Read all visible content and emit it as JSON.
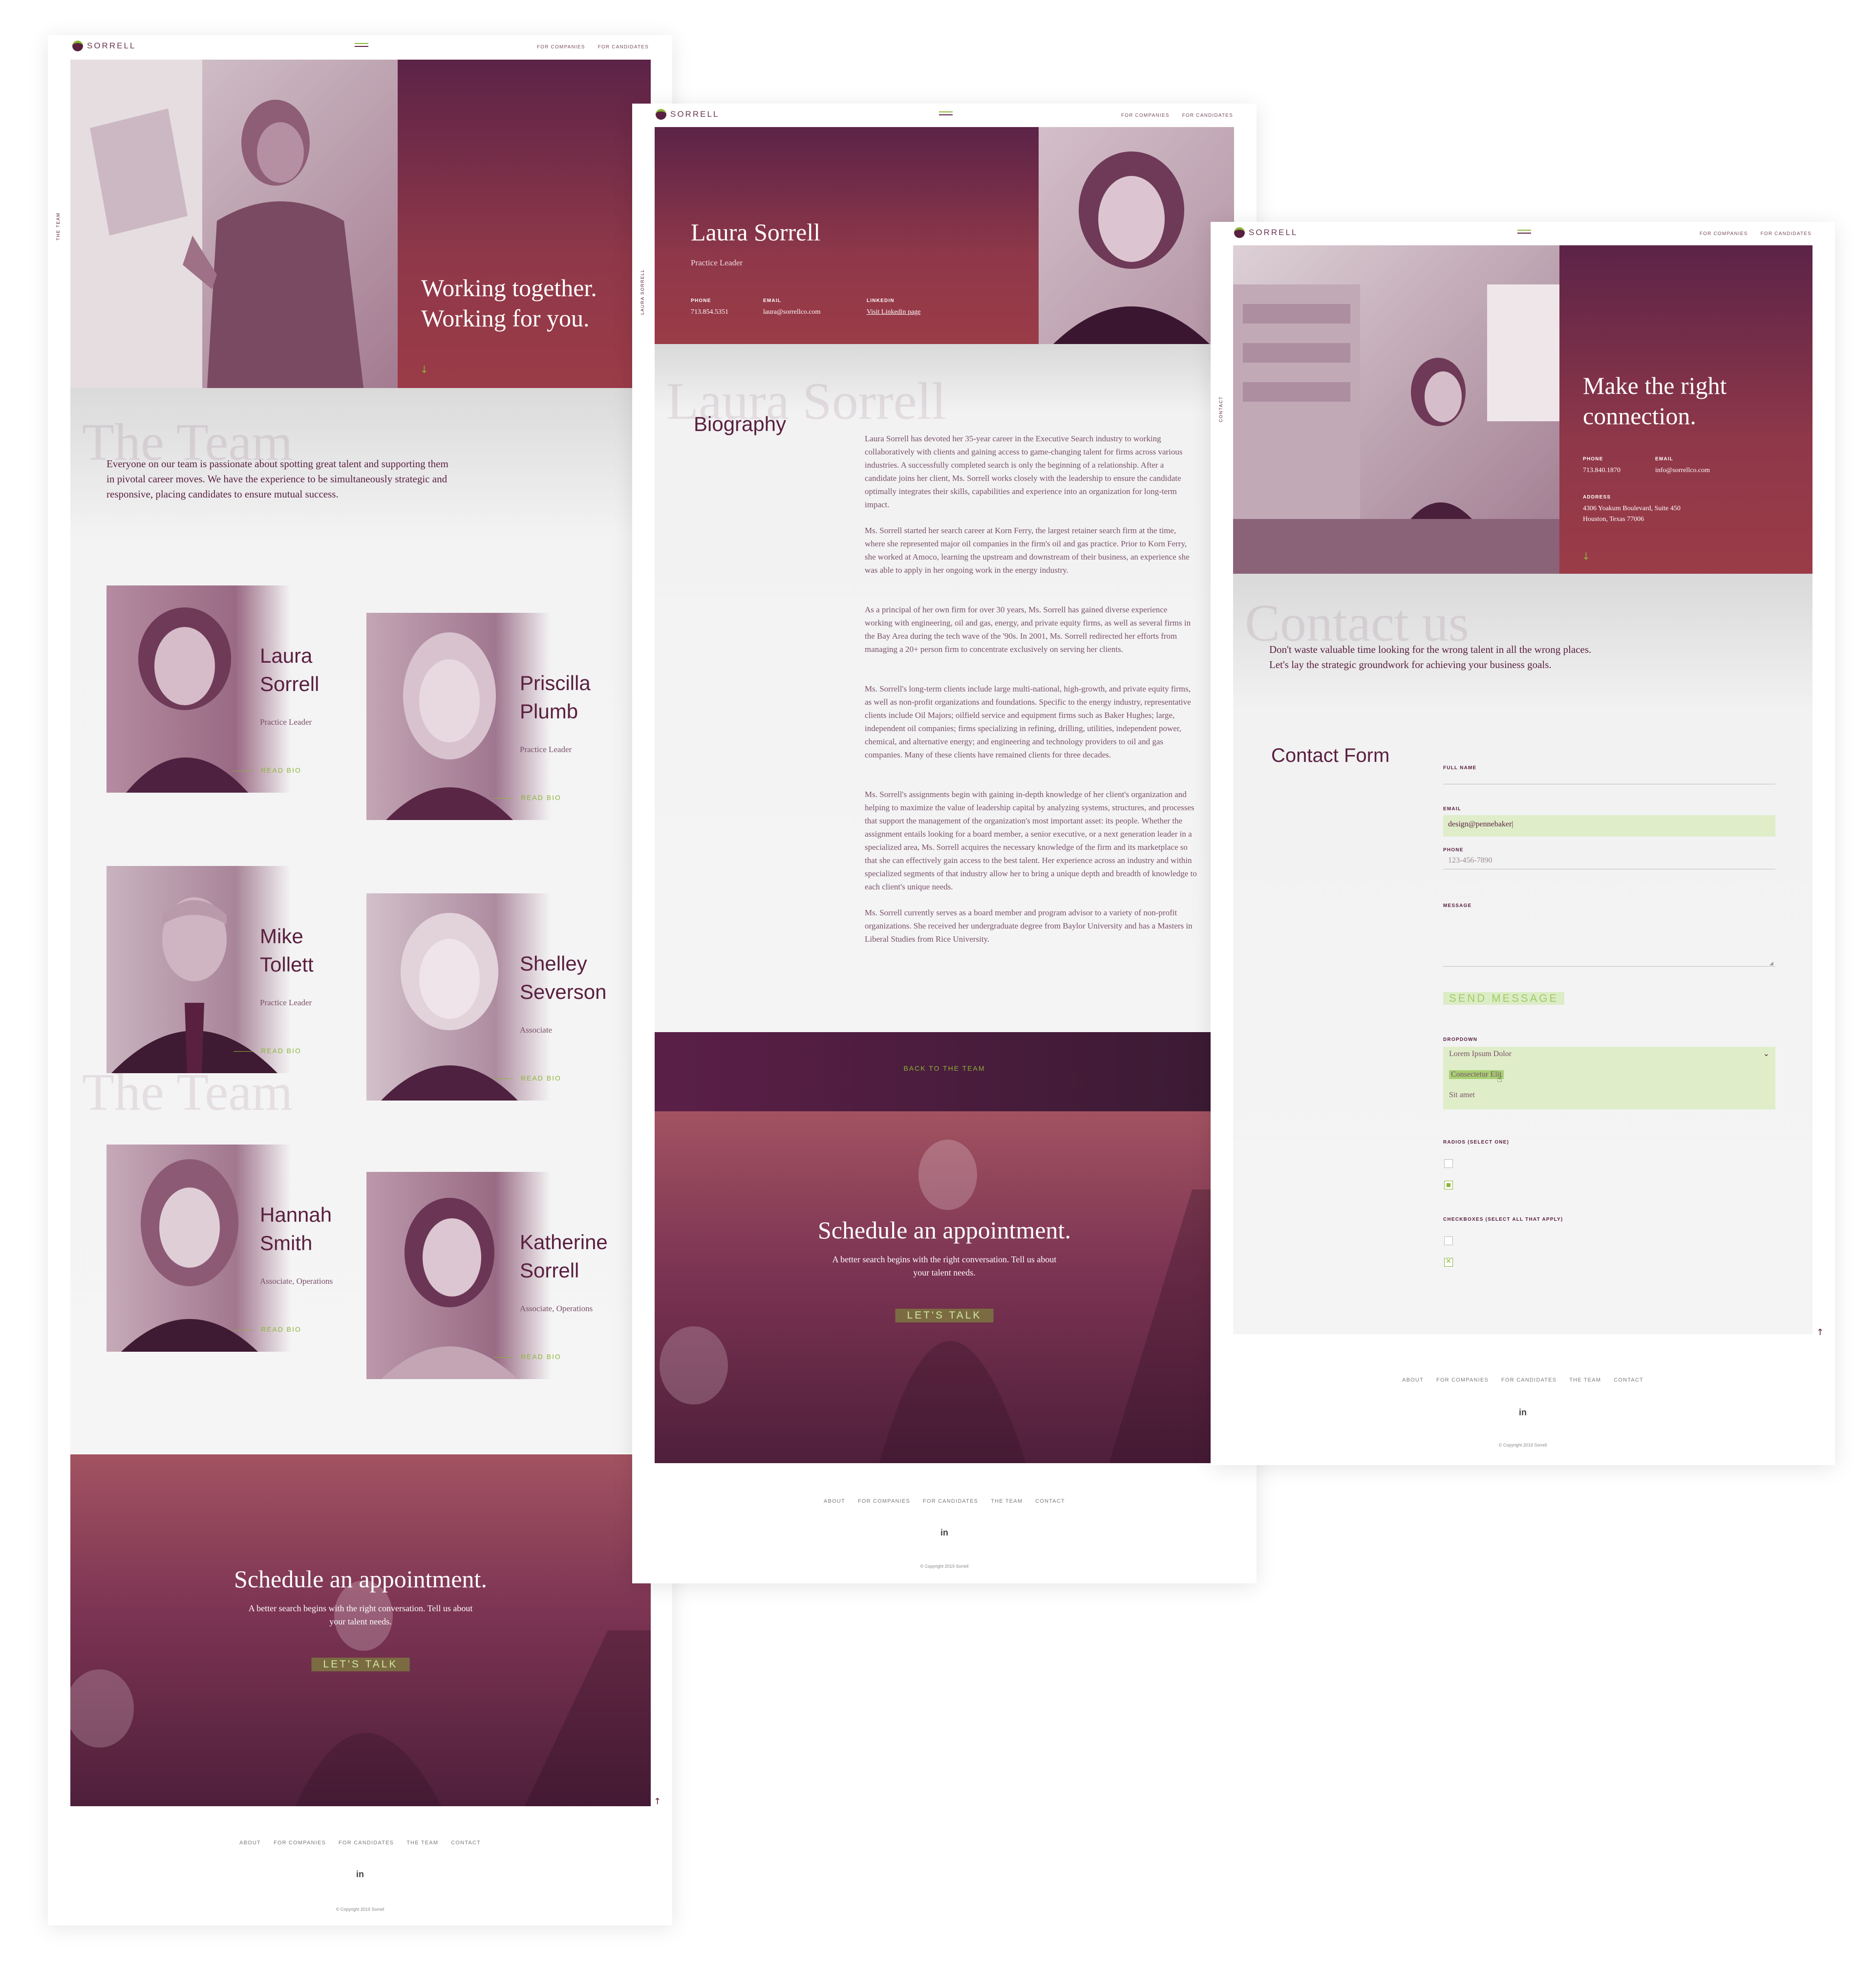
{
  "brand": {
    "name": "SORRELL"
  },
  "nav": {
    "for_companies": "FOR COMPANIES",
    "for_candidates": "FOR CANDIDATES"
  },
  "footer": {
    "links": [
      "ABOUT",
      "FOR COMPANIES",
      "FOR CANDIDATES",
      "THE TEAM",
      "CONTACT"
    ],
    "linkedin": "in",
    "copyright": "© Copyright 2019 Sorrell"
  },
  "team_page": {
    "side_label": "THE TEAM",
    "hero_title_1": "Working together.",
    "hero_title_2": "Working for you.",
    "ghost_heading": "The Team",
    "intro": "Everyone on our team is passionate about spotting great talent and supporting them in pivotal career moves. We have the experience to be simultaneously strategic and responsive, placing candidates to ensure mutual success.",
    "read_bio": "READ BIO",
    "members": [
      {
        "first": "Laura",
        "last": "Sorrell",
        "role": "Practice Leader"
      },
      {
        "first": "Priscilla",
        "last": "Plumb",
        "role": "Practice Leader"
      },
      {
        "first": "Mike",
        "last": "Tollett",
        "role": "Practice Leader"
      },
      {
        "first": "Shelley",
        "last": "Severson",
        "role": "Associate"
      },
      {
        "first": "Hannah",
        "last": "Smith",
        "role": "Associate, Operations"
      },
      {
        "first": "Katherine",
        "last": "Sorrell",
        "role": "Associate, Operations"
      }
    ],
    "cta": {
      "title": "Schedule an appointment.",
      "sub_1": "A better search begins with the right conversation. Tell us about",
      "sub_2": "your talent needs.",
      "button": "LET'S TALK"
    }
  },
  "bio_page": {
    "side_label": "LAURA SORRELL",
    "name": "Laura Sorrell",
    "title": "Practice Leader",
    "phone_label": "PHONE",
    "phone": "713.854.5351",
    "email_label": "EMAIL",
    "email": "laura@sorrellco.com",
    "linkedin_label": "LINKEDIN",
    "linkedin": "Visit Linkedin page",
    "ghost_name": "Laura Sorrell",
    "section_heading": "Biography",
    "paragraphs": [
      "Laura Sorrell has devoted her 35-year career in the Executive Search industry to working collaboratively with clients and gaining access to game-changing talent for firms across various industries. A successfully completed search is only the beginning of a relationship. After a candidate joins her client, Ms. Sorrell works closely with the leadership to ensure the candidate optimally integrates their skills, capabilities and experience into an organization for long-term impact.",
      "Ms. Sorrell started her search career at Korn Ferry, the largest retainer search firm at the time, where she represented major oil companies in the firm's oil and gas practice. Prior to Korn Ferry, she worked at Amoco, learning the upstream and downstream of their business, an experience she was able to apply in her ongoing work in the energy industry.",
      "As a principal of her own firm for over 30 years, Ms. Sorrell has gained diverse experience working with engineering, oil and gas, energy, and private equity firms, as well as several firms in the Bay Area during the tech wave of the '90s. In 2001, Ms. Sorrell redirected her efforts from managing a 20+ person firm to concentrate exclusively on serving her clients.",
      "Ms. Sorrell's long-term clients include large multi-national, high-growth, and private equity firms, as well as non-profit organizations and foundations. Specific to the energy industry, representative clients include Oil Majors; oilfield service and equipment firms such as Baker Hughes; large, independent oil companies; firms specializing in refining, drilling, utilities, independent power, chemical, and alternative energy; and engineering and technology providers to oil and gas companies. Many of these clients have remained clients for three decades.",
      "Ms. Sorrell's assignments begin with gaining in-depth knowledge of her client's organization and helping to maximize the value of leadership capital by analyzing systems, structures, and processes that support the management of the organization's most important asset: its people. Whether the assignment entails looking for a board member, a senior executive, or a next generation leader in a specialized area, Ms. Sorrell acquires the necessary knowledge of the firm and its marketplace so that she can effectively gain access to the best talent. Her experience across an industry and within specialized segments of that industry allow her to bring a unique depth and breadth of knowledge to each client's unique needs.",
      "Ms. Sorrell currently serves as a board member and program advisor to a variety of non-profit organizations. She received her undergraduate degree from Baylor University and has a Masters in Liberal Studies from Rice University."
    ],
    "back_link": "BACK TO THE TEAM",
    "cta": {
      "title": "Schedule an appointment.",
      "sub_1": "A better search begins with the right conversation. Tell us about",
      "sub_2": "your talent needs.",
      "button": "LET'S TALK"
    }
  },
  "contact_page": {
    "side_label": "CONTACT",
    "hero_title_1": "Make the right",
    "hero_title_2": "connection.",
    "phone_label": "PHONE",
    "phone": "713.840.1870",
    "email_label": "EMAIL",
    "email": "info@sorrellco.com",
    "address_label": "ADDRESS",
    "address_1": "4306 Yoakum Boulevard, Suite 450",
    "address_2": "Houston, Texas 77006",
    "ghost_heading": "Contact us",
    "intro": "Don't waste valuable time looking for the wrong talent in all the wrong places. Let's lay the strategic groundwork for achieving your business goals.",
    "form_heading": "Contact Form",
    "full_name_label": "FULL NAME",
    "full_name_value": "",
    "email_label_form": "EMAIL",
    "email_value": "design@pennebaker|",
    "phone_label_form": "PHONE",
    "phone_placeholder": "123-456-7890",
    "message_label": "MESSAGE",
    "send_button": "SEND MESSAGE",
    "dropdown_label": "DROPDOWN",
    "dropdown_selected": "Lorem Ipsum Dolor",
    "dropdown_options": [
      "Consectetur Elit",
      "Sit amet"
    ],
    "radios_label": "RADIOS (SELECT ONE)",
    "checkboxes_label": "CHECKBOXES (SELECT ALL THAT APPLY)"
  },
  "colors": {
    "accent": "#8ab536",
    "brand": "#5a2040",
    "hero": "#8f3849"
  }
}
